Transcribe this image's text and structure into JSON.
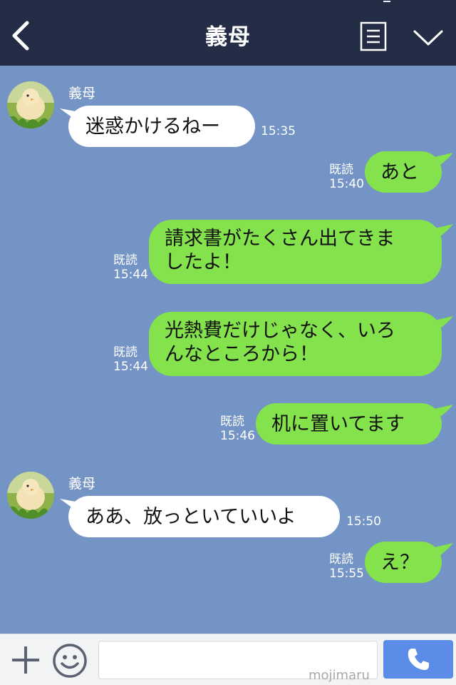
{
  "header": {
    "title": "義母"
  },
  "messages": [
    {
      "direction": "in",
      "sender": "義母",
      "text": "迷惑かけるねー",
      "time": "15:35"
    },
    {
      "direction": "out",
      "read": "既読",
      "time": "15:40",
      "text": "あと"
    },
    {
      "direction": "out",
      "read": "既読",
      "time": "15:44",
      "line1": "請求書がたくさん出てきま",
      "line2": "したよ！"
    },
    {
      "direction": "out",
      "read": "既読",
      "time": "15:44",
      "line1": "光熱費だけじゃなく、いろ",
      "line2": "んなところから！"
    },
    {
      "direction": "out",
      "read": "既読",
      "time": "15:46",
      "text": "机に置いてます"
    },
    {
      "direction": "in",
      "sender": "義母",
      "text": "ああ、放っといていいよ",
      "time": "15:50"
    },
    {
      "direction": "out",
      "read": "既読",
      "time": "15:55",
      "text": "え？"
    }
  ],
  "input": {
    "placeholder": "",
    "watermark": "mojimaru"
  },
  "colors": {
    "background": "#7394c4",
    "header": "#232d45",
    "outgoing_bubble": "#84e24c",
    "incoming_bubble": "#ffffff",
    "call_button": "#5b8de8"
  },
  "icons": [
    "back-icon",
    "menu-icon",
    "chevron-down-icon",
    "plus-icon",
    "smile-icon",
    "phone-icon"
  ]
}
